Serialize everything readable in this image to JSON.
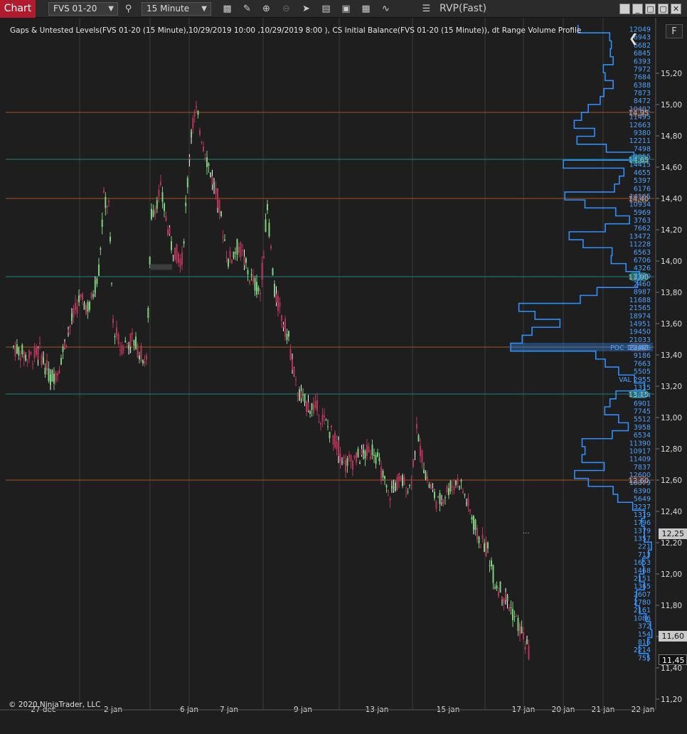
{
  "toolbar": {
    "chart_tab": "Chart",
    "instrument": "FVS 01-20",
    "interval": "15 Minute",
    "chart_title": "RVP(Fast)",
    "icons": [
      "search-icon",
      "bar-type-icon",
      "draw-icon",
      "zoom-in-icon",
      "zoom-out-icon",
      "select-icon",
      "properties-icon",
      "templates-icon",
      "strategies-icon",
      "indicators-icon",
      "menu-icon"
    ]
  },
  "indicator_caption": "Gaps & Untested Levels(FVS 01-20 (15 Minute),10/29/2019 10:00 ,10/29/2019 8:00 ), CS Initial Balance(FVS 01-20 (15 Minute)), dt Range Volume Profile",
  "copyright": "© 2020 NinjaTrader, LLC",
  "f_button": "F",
  "price_axis": {
    "ticks": [
      "15,20",
      "15,00",
      "14,80",
      "14,60",
      "14,40",
      "14,20",
      "14,00",
      "13,80",
      "13,60",
      "13,40",
      "13,20",
      "13,00",
      "12,80",
      "12,60",
      "12,40",
      "12,20",
      "12,00",
      "11,80",
      "11,60",
      "11,40",
      "11,20"
    ],
    "tags": [
      {
        "label": "12,25",
        "style": "light"
      },
      {
        "label": "11,60",
        "style": "light"
      },
      {
        "label": "11,45",
        "style": "dark"
      }
    ]
  },
  "time_axis": [
    "27 dec",
    "2 jan",
    "6 jan",
    "7 jan",
    "9 jan",
    "13 jan",
    "15 jan",
    "17 jan",
    "20 jan",
    "21 jan",
    "22 jan"
  ],
  "level_markers": [
    "14,95",
    "14,65",
    "14,40",
    "13,90",
    "13,45",
    "13,15",
    "12,60"
  ],
  "volume_labels": [
    "12049",
    "6943",
    "6682",
    "6845",
    "6393",
    "7972",
    "7684",
    "6388",
    "7873",
    "8472",
    "10402",
    "11495",
    "12663",
    "9380",
    "12211",
    "7498",
    "3055",
    "14415",
    "4655",
    "5397",
    "6176",
    "14165",
    "10934",
    "5969",
    "3763",
    "7662",
    "13472",
    "11228",
    "6563",
    "6706",
    "4326",
    "2130",
    "2460",
    "8987",
    "11688",
    "21565",
    "18974",
    "14951",
    "19450",
    "21033",
    "22896",
    "9186",
    "7663",
    "5505",
    "VAL 2955",
    "1315",
    "5934",
    "6901",
    "7745",
    "5512",
    "3958",
    "6534",
    "11390",
    "10917",
    "11409",
    "7837",
    "12600",
    "10379",
    "6390",
    "5649",
    "3237",
    "1319",
    "1796",
    "1379",
    "1357",
    "221",
    "713",
    "1653",
    "1468",
    "2151",
    "1365",
    "2607",
    "2780",
    "2161",
    "1086",
    "372",
    "154",
    "816",
    "2214",
    "755"
  ],
  "poc_label": "POC 13,45",
  "val_label": "VAL 2955",
  "colors": {
    "background": "#1e1e1e",
    "grid": "#3a3a3a",
    "up_candle": "#7fd07f",
    "down_candle": "#b5345a",
    "profile": "#2f8fff",
    "level_orange": "#8b4a1e",
    "level_teal": "#1f6f6a"
  }
}
